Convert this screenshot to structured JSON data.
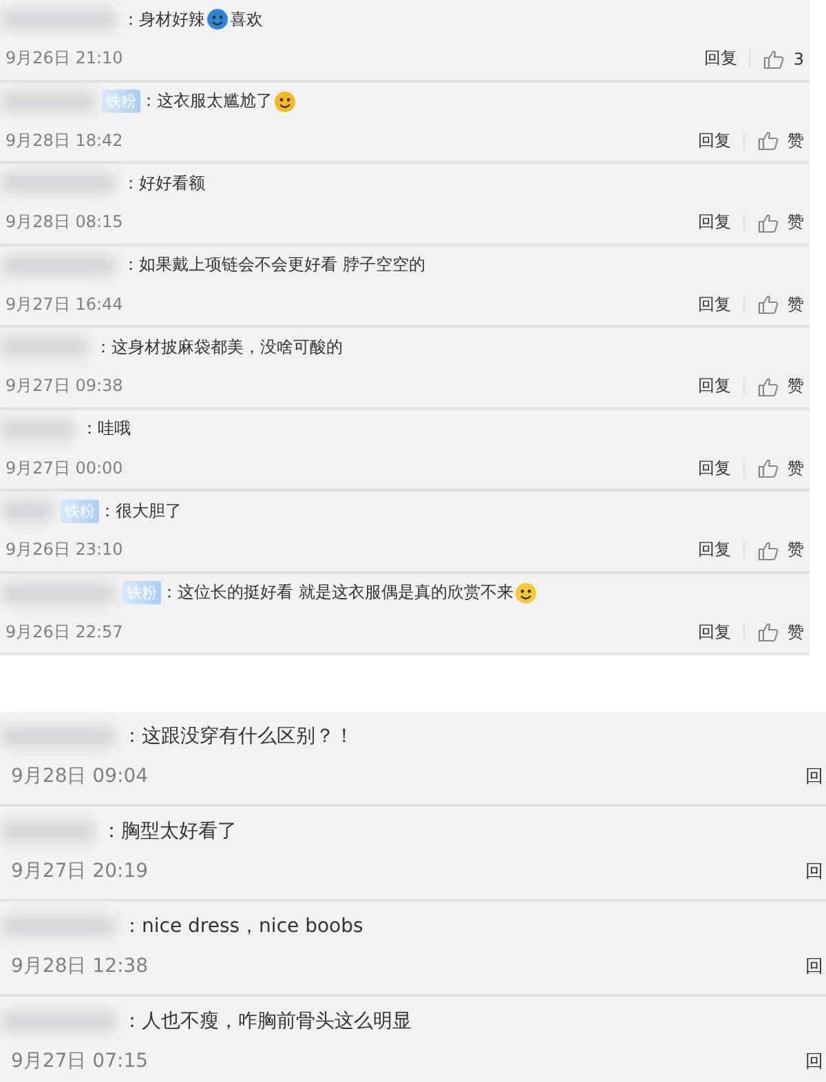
{
  "sections": [
    {
      "kind": "compact",
      "comments": [
        {
          "segments": [
            {
              "kind": "text",
              "text": "：身材好辣"
            },
            {
              "kind": "emoji",
              "color": "#2f86d6"
            },
            {
              "kind": "text",
              "text": "喜欢"
            }
          ],
          "time": "9月26日 21:10",
          "reply": "回复",
          "like": "3"
        },
        {
          "badge": "铁粉",
          "segments": [
            {
              "kind": "text",
              "text": "：这衣服太尴尬了"
            },
            {
              "kind": "emoji",
              "color": "#f5b820"
            }
          ],
          "time": "9月28日 18:42",
          "reply": "回复",
          "like": "赞"
        },
        {
          "segments": [
            {
              "kind": "text",
              "text": "：好好看额"
            }
          ],
          "time": "9月28日 08:15",
          "reply": "回复",
          "like": "赞"
        },
        {
          "segments": [
            {
              "kind": "text",
              "text": "：如果戴上项链会不会更好看 脖子空空的"
            }
          ],
          "time": "9月27日 16:44",
          "reply": "回复",
          "like": "赞"
        },
        {
          "segments": [
            {
              "kind": "text",
              "text": "：这身材披麻袋都美，没啥可酸的"
            }
          ],
          "time": "9月27日 09:38",
          "reply": "回复",
          "like": "赞"
        },
        {
          "segments": [
            {
              "kind": "text",
              "text": "：哇哦"
            }
          ],
          "time": "9月27日 00:00",
          "reply": "回复",
          "like": "赞"
        },
        {
          "badge": "铁粉",
          "segments": [
            {
              "kind": "text",
              "text": "：很大胆了"
            }
          ],
          "time": "9月26日 23:10",
          "reply": "回复",
          "like": "赞"
        },
        {
          "badge": "铁粉",
          "segments": [
            {
              "kind": "text",
              "text": "：这位长的挺好看 就是这衣服偶是真的欣赏不来"
            },
            {
              "kind": "emoji",
              "color": "#f5c838"
            }
          ],
          "time": "9月26日 22:57",
          "reply": "回复",
          "like": "赞"
        }
      ]
    },
    {
      "kind": "wide",
      "comments": [
        {
          "segments": [
            {
              "kind": "text",
              "text": "：这跟没穿有什么区别？！"
            }
          ],
          "time": "9月28日 09:04",
          "reply": "回"
        },
        {
          "segments": [
            {
              "kind": "text",
              "text": "：胸型太好看了"
            }
          ],
          "time": "9月27日 20:19",
          "reply": "回"
        },
        {
          "segments": [
            {
              "kind": "text",
              "text": "：nice dress，nice boobs"
            }
          ],
          "time": "9月28日 12:38",
          "reply": "回"
        },
        {
          "segments": [
            {
              "kind": "text",
              "text": "：人也不瘦，咋胸前骨头这么明显"
            }
          ],
          "time": "9月27日 07:15",
          "reply": "回"
        }
      ]
    }
  ]
}
